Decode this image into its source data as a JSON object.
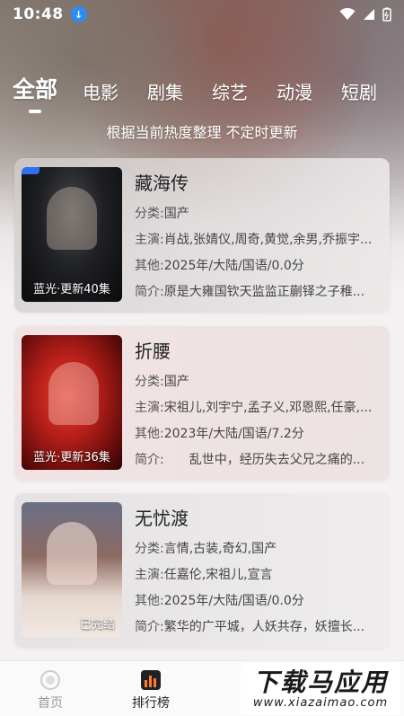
{
  "status_bar": {
    "time": "10:48"
  },
  "tabs": [
    {
      "label": "全部",
      "active": true
    },
    {
      "label": "电影",
      "active": false
    },
    {
      "label": "剧集",
      "active": false
    },
    {
      "label": "综艺",
      "active": false
    },
    {
      "label": "动漫",
      "active": false
    },
    {
      "label": "短剧",
      "active": false
    }
  ],
  "subtitle": "根据当前热度整理 不定时更新",
  "items": [
    {
      "title": "藏海传",
      "poster_badge": "蓝光·更新40集",
      "category_label": "分类:",
      "category": "国产",
      "cast_label": "主演:",
      "cast": "肖战,张婧仪,周奇,黄觉,余男,乔振宇...",
      "other_label": "其他:",
      "other": "2025年/大陆/国语/0.0分",
      "intro_label": "简介:",
      "intro": "原是大雍国钦天监监正蒯铎之子稚..."
    },
    {
      "title": "折腰",
      "poster_badge": "蓝光·更新36集",
      "category_label": "分类:",
      "category": "国产",
      "cast_label": "主演:",
      "cast": "宋祖儿,刘宇宁,孟子义,邓恩熙,任豪,...",
      "other_label": "其他:",
      "other": "2023年/大陆/国语/7.2分",
      "intro_label": "简介:",
      "intro": "　　乱世中，经历失去父兄之痛的..."
    },
    {
      "title": "无忧渡",
      "poster_badge": "已完结",
      "category_label": "分类:",
      "category": "言情,古装,奇幻,国产",
      "cast_label": "主演:",
      "cast": "任嘉伦,宋祖儿,宣言",
      "other_label": "其他:",
      "other": "2025年/大陆/国语/0.0分",
      "intro_label": "简介:",
      "intro": "繁华的广平城，人妖共存，妖擅长..."
    }
  ],
  "bottom_nav": {
    "home": "首页",
    "rank": "排行榜"
  },
  "watermark": {
    "main": "下载马应用",
    "sub": "www.xiazaimao.com"
  }
}
